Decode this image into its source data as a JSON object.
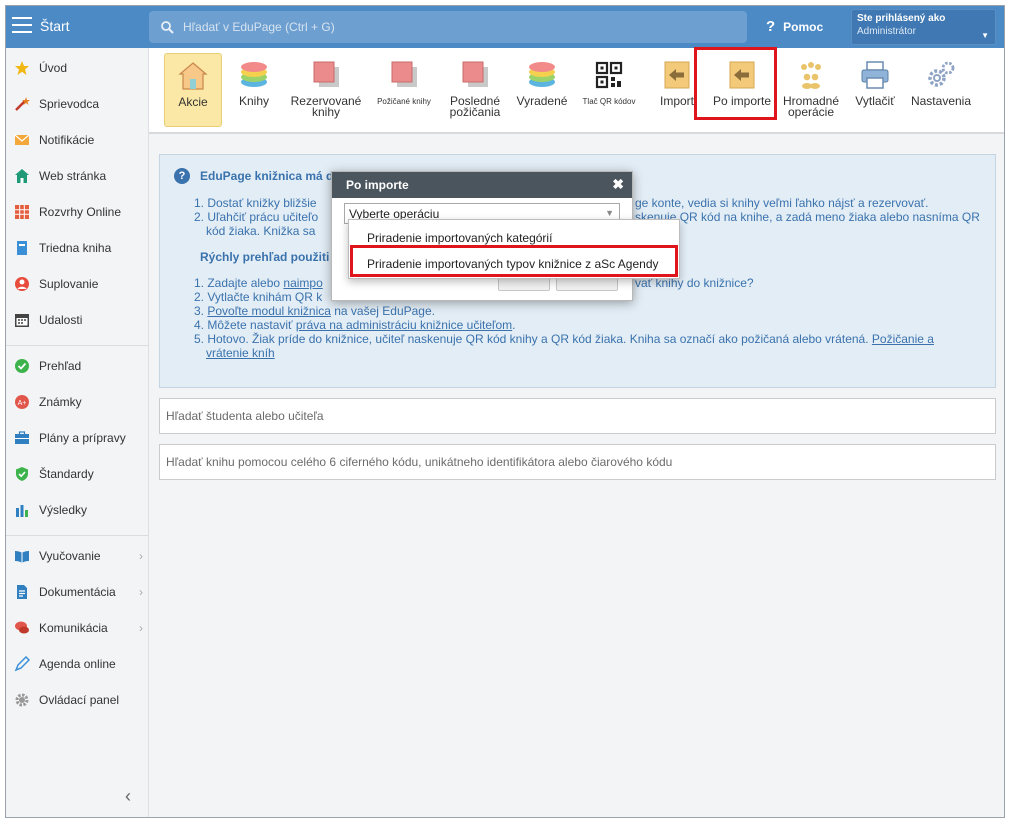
{
  "header": {
    "app_title": "Štart",
    "search_placeholder": "Hľadať v EduPage (Ctrl + G)",
    "help_label": "Pomoc",
    "user_line1": "Ste prihlásený ako",
    "user_line2": "Administrátor"
  },
  "sidebar": {
    "items": [
      {
        "label": "Úvod",
        "icon": "star-icon"
      },
      {
        "label": "Sprievodca",
        "icon": "wand-icon"
      },
      {
        "label": "Notifikácie",
        "icon": "envelope-icon"
      },
      {
        "label": "Web stránka",
        "icon": "house-icon"
      },
      {
        "label": "Rozvrhy Online",
        "icon": "grid-icon"
      },
      {
        "label": "Triedna kniha",
        "icon": "book-icon"
      },
      {
        "label": "Suplovanie",
        "icon": "person-icon"
      },
      {
        "label": "Udalosti",
        "icon": "calendar-icon"
      },
      {
        "label": "Prehľad",
        "icon": "check-circle-icon"
      },
      {
        "label": "Známky",
        "icon": "grades-icon"
      },
      {
        "label": "Plány a prípravy",
        "icon": "briefcase-icon"
      },
      {
        "label": "Štandardy",
        "icon": "shield-check-icon"
      },
      {
        "label": "Výsledky",
        "icon": "bar-chart-icon"
      },
      {
        "label": "Vyučovanie",
        "icon": "open-book-icon"
      },
      {
        "label": "Dokumentácia",
        "icon": "document-icon"
      },
      {
        "label": "Komunikácia",
        "icon": "chat-icon"
      },
      {
        "label": "Agenda online",
        "icon": "pen-icon"
      },
      {
        "label": "Ovládací panel",
        "icon": "gear-icon"
      }
    ]
  },
  "toolbar": {
    "items": [
      {
        "label": "Akcie",
        "icon": "house-icon"
      },
      {
        "label": "Knihy",
        "icon": "stack-icon"
      },
      {
        "label": "Rezervované knihy",
        "icon": "book-pages-icon"
      },
      {
        "label": "Požičané knihy",
        "icon": "book-pages-icon"
      },
      {
        "label": "Posledné požičania",
        "icon": "book-pages-icon"
      },
      {
        "label": "Vyradené",
        "icon": "stack-icon"
      },
      {
        "label": "Tlač QR kódov",
        "icon": "qr-icon"
      },
      {
        "label": "Import",
        "icon": "import-icon"
      },
      {
        "label": "Po importe",
        "icon": "import-icon"
      },
      {
        "label": "Hromadné operácie",
        "icon": "people-icon"
      },
      {
        "label": "Vytlačiť",
        "icon": "printer-icon"
      },
      {
        "label": "Nastavenia",
        "icon": "gears-icon"
      }
    ]
  },
  "info": {
    "title": "EduPage knižnica má d",
    "line1a": "1. Dostať knižky bližšie",
    "line1b": "ge konte, vedia si knihy veľmi ľahko nájsť a rezervovať.",
    "line2a": "2. Uľahčiť prácu učiteľo",
    "line2b": "skenuje QR kód na knihe, a zadá meno žiaka alebo nasníma QR",
    "line2c": "kód žiaka. Knižka sa",
    "subtitle": "Rýchly prehľad použiti",
    "step1a": "1. Zadajte alebo",
    "step1link": "naimpo",
    "step1b": "vať knihy do knižnice?",
    "step2a": "2. Vytlačte knihám QR k",
    "step3link": "Povoľte modul knižnica",
    "step3b": "na vašej EduPage.",
    "step4a": "4. Môžete nastaviť",
    "step4link": "práva na administráciu knižnice učiteľom",
    "step5a": "5. Hotovo. Žiak príde do knižnice, učiteľ naskenuje QR kód knihy a QR kód žiaka. Kniha sa označí ako požičaná alebo vrátená.",
    "step5link1": "Požičanie a",
    "step5link2": "vrátenie kníh"
  },
  "search_student_placeholder": "Hľadať študenta alebo učiteľa",
  "search_book_placeholder": "Hľadať knihu pomocou celého 6 ciferného kódu, unikátneho identifikátora alebo čiarového kódu",
  "dialog": {
    "title": "Po importe",
    "select_value": "Vyberte operáciu",
    "options": [
      "Priradenie importovaných kategórií",
      "Priradenie importovaných typov knižnice z aSc Agendy"
    ]
  },
  "colors": {
    "topbar": "#4c8ac6",
    "highlight": "#e0141b",
    "active_tab": "#fbe8a6"
  }
}
